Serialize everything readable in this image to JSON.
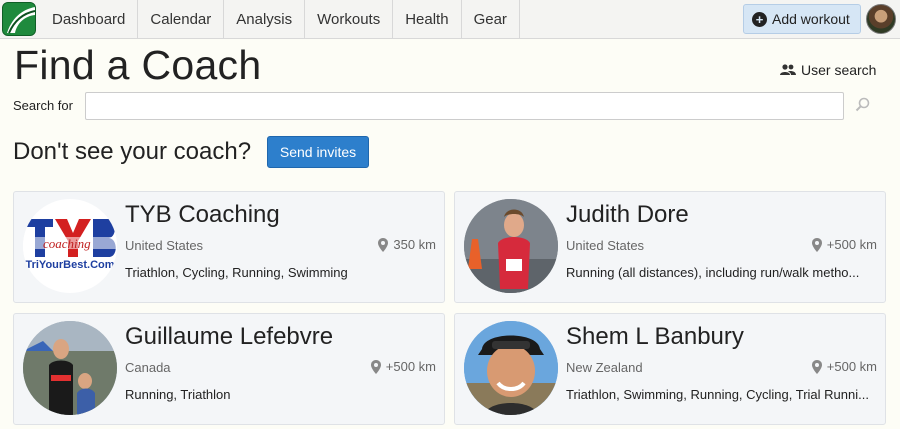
{
  "nav": {
    "items": [
      "Dashboard",
      "Calendar",
      "Analysis",
      "Workouts",
      "Health",
      "Gear"
    ],
    "add_workout": "Add workout"
  },
  "page": {
    "title": "Find a Coach",
    "user_search": "User search",
    "search_label": "Search for",
    "search_value": "",
    "dont_see": "Don't see your coach?",
    "send_invites": "Send invites"
  },
  "coaches": [
    {
      "name": "TYB Coaching",
      "country": "United States",
      "distance": "350 km",
      "sports": "Triathlon, Cycling, Running, Swimming",
      "logo_text": "TriYourBest.Com"
    },
    {
      "name": "Judith Dore",
      "country": "United States",
      "distance": "+500 km",
      "sports": "Running (all distances), including run/walk metho..."
    },
    {
      "name": "Guillaume Lefebvre",
      "country": "Canada",
      "distance": "+500 km",
      "sports": "Running, Triathlon"
    },
    {
      "name": "Shem L Banbury",
      "country": "New Zealand",
      "distance": "+500 km",
      "sports": "Triathlon, Swimming, Running, Cycling, Trial Runni..."
    }
  ],
  "colors": {
    "accent": "#2d7fcc",
    "logo_green": "#1f8a3d"
  }
}
